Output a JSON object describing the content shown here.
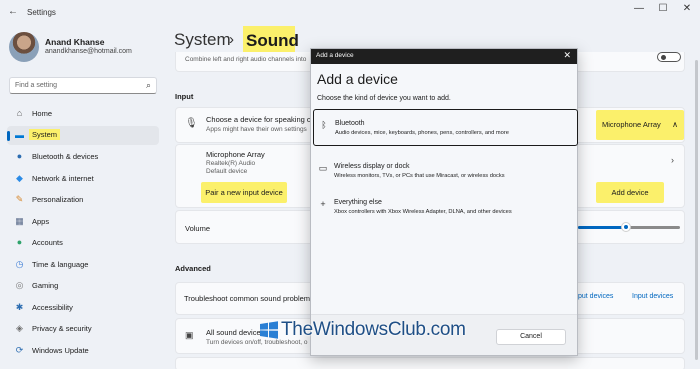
{
  "window": {
    "title": "Settings",
    "back_icon": "back-arrow-icon",
    "controls": [
      "minimize-icon",
      "maximize-icon",
      "close-icon"
    ]
  },
  "profile": {
    "name": "Anand Khanse",
    "email": "anandkhanse@hotmail.com"
  },
  "search": {
    "placeholder": "Find a setting",
    "icon": "search-icon"
  },
  "sidebar": {
    "items": [
      {
        "label": "Home",
        "icon": "home-icon",
        "glyph": "⌂",
        "color": "#5a5a5a"
      },
      {
        "label": "System",
        "icon": "system-icon",
        "glyph": "▬",
        "color": "#0078d4",
        "active": true
      },
      {
        "label": "Bluetooth & devices",
        "icon": "bluetooth-icon",
        "glyph": "●",
        "color": "#2b6cb0"
      },
      {
        "label": "Network & internet",
        "icon": "network-icon",
        "glyph": "◆",
        "color": "#2b8be6"
      },
      {
        "label": "Personalization",
        "icon": "personalization-icon",
        "glyph": "✎",
        "color": "#d6862a"
      },
      {
        "label": "Apps",
        "icon": "apps-icon",
        "glyph": "▦",
        "color": "#5a6b8a"
      },
      {
        "label": "Accounts",
        "icon": "accounts-icon",
        "glyph": "●",
        "color": "#2ea36b"
      },
      {
        "label": "Time & language",
        "icon": "time-language-icon",
        "glyph": "◷",
        "color": "#3a7bd5"
      },
      {
        "label": "Gaming",
        "icon": "gaming-icon",
        "glyph": "◎",
        "color": "#7a7a7a"
      },
      {
        "label": "Accessibility",
        "icon": "accessibility-icon",
        "glyph": "✱",
        "color": "#2b6cb0"
      },
      {
        "label": "Privacy & security",
        "icon": "shield-icon",
        "glyph": "◈",
        "color": "#6b6b6b"
      },
      {
        "label": "Windows Update",
        "icon": "update-icon",
        "glyph": "⟳",
        "color": "#2b6cb0"
      }
    ]
  },
  "breadcrumb": {
    "parent": "System",
    "separator": "›",
    "current": "Sound"
  },
  "main": {
    "combine_text": "Combine left and right audio channels into",
    "input_section": "Input",
    "choose_device": {
      "title": "Choose a device for speaking o",
      "subtitle": "Apps might have their own settings",
      "selected_value": "Microphone Array",
      "icon": "microphone-icon"
    },
    "mic": {
      "title": "Microphone Array",
      "line1": "Realtek(R) Audio",
      "line2": "Default device"
    },
    "pair_label": "Pair a new input device",
    "add_device_label": "Add device",
    "volume_label": "Volume",
    "volume_level": 0.47,
    "advanced_section": "Advanced",
    "troubleshoot": {
      "title": "Troubleshoot common sound problem",
      "link1": "put devices",
      "link2": "Input devices"
    },
    "all_sound": {
      "title": "All sound devices",
      "subtitle": "Turn devices on/off, troubleshoot, o"
    }
  },
  "dialog": {
    "titlebar": "Add a device",
    "heading": "Add a device",
    "instruction": "Choose the kind of device you want to add.",
    "options": [
      {
        "title": "Bluetooth",
        "desc": "Audio devices, mice, keyboards, phones, pens, controllers, and more",
        "icon": "bluetooth-icon",
        "glyph": "ᛒ",
        "selected": true
      },
      {
        "title": "Wireless display or dock",
        "desc": "Wireless monitors, TVs, or PCs that use Miracast, or wireless docks",
        "icon": "monitor-icon",
        "glyph": "▭",
        "selected": false
      },
      {
        "title": "Everything else",
        "desc": "Xbox controllers with Xbox Wireless Adapter, DLNA, and other devices",
        "icon": "plus-icon",
        "glyph": "+",
        "selected": false
      }
    ],
    "cancel_label": "Cancel"
  },
  "watermark": {
    "text": "TheWindowsClub.com"
  },
  "colors": {
    "accent": "#0067c0",
    "highlight": "#fbf06b",
    "watermark_blue": "#1f4f86"
  }
}
